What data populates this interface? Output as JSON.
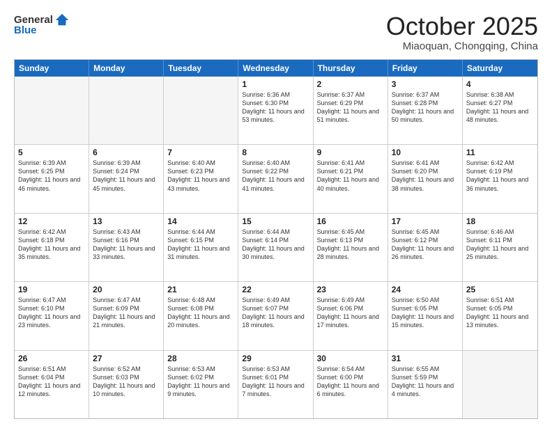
{
  "header": {
    "logo_general": "General",
    "logo_blue": "Blue",
    "month": "October 2025",
    "location": "Miaoquan, Chongqing, China"
  },
  "days_of_week": [
    "Sunday",
    "Monday",
    "Tuesday",
    "Wednesday",
    "Thursday",
    "Friday",
    "Saturday"
  ],
  "weeks": [
    [
      {
        "day": "",
        "empty": true
      },
      {
        "day": "",
        "empty": true
      },
      {
        "day": "",
        "empty": true
      },
      {
        "day": "1",
        "sunrise": "6:36 AM",
        "sunset": "6:30 PM",
        "daylight": "11 hours and 53 minutes."
      },
      {
        "day": "2",
        "sunrise": "6:37 AM",
        "sunset": "6:29 PM",
        "daylight": "11 hours and 51 minutes."
      },
      {
        "day": "3",
        "sunrise": "6:37 AM",
        "sunset": "6:28 PM",
        "daylight": "11 hours and 50 minutes."
      },
      {
        "day": "4",
        "sunrise": "6:38 AM",
        "sunset": "6:27 PM",
        "daylight": "11 hours and 48 minutes."
      }
    ],
    [
      {
        "day": "5",
        "sunrise": "6:39 AM",
        "sunset": "6:25 PM",
        "daylight": "11 hours and 46 minutes."
      },
      {
        "day": "6",
        "sunrise": "6:39 AM",
        "sunset": "6:24 PM",
        "daylight": "11 hours and 45 minutes."
      },
      {
        "day": "7",
        "sunrise": "6:40 AM",
        "sunset": "6:23 PM",
        "daylight": "11 hours and 43 minutes."
      },
      {
        "day": "8",
        "sunrise": "6:40 AM",
        "sunset": "6:22 PM",
        "daylight": "11 hours and 41 minutes."
      },
      {
        "day": "9",
        "sunrise": "6:41 AM",
        "sunset": "6:21 PM",
        "daylight": "11 hours and 40 minutes."
      },
      {
        "day": "10",
        "sunrise": "6:41 AM",
        "sunset": "6:20 PM",
        "daylight": "11 hours and 38 minutes."
      },
      {
        "day": "11",
        "sunrise": "6:42 AM",
        "sunset": "6:19 PM",
        "daylight": "11 hours and 36 minutes."
      }
    ],
    [
      {
        "day": "12",
        "sunrise": "6:42 AM",
        "sunset": "6:18 PM",
        "daylight": "11 hours and 35 minutes."
      },
      {
        "day": "13",
        "sunrise": "6:43 AM",
        "sunset": "6:16 PM",
        "daylight": "11 hours and 33 minutes."
      },
      {
        "day": "14",
        "sunrise": "6:44 AM",
        "sunset": "6:15 PM",
        "daylight": "11 hours and 31 minutes."
      },
      {
        "day": "15",
        "sunrise": "6:44 AM",
        "sunset": "6:14 PM",
        "daylight": "11 hours and 30 minutes."
      },
      {
        "day": "16",
        "sunrise": "6:45 AM",
        "sunset": "6:13 PM",
        "daylight": "11 hours and 28 minutes."
      },
      {
        "day": "17",
        "sunrise": "6:45 AM",
        "sunset": "6:12 PM",
        "daylight": "11 hours and 26 minutes."
      },
      {
        "day": "18",
        "sunrise": "6:46 AM",
        "sunset": "6:11 PM",
        "daylight": "11 hours and 25 minutes."
      }
    ],
    [
      {
        "day": "19",
        "sunrise": "6:47 AM",
        "sunset": "6:10 PM",
        "daylight": "11 hours and 23 minutes."
      },
      {
        "day": "20",
        "sunrise": "6:47 AM",
        "sunset": "6:09 PM",
        "daylight": "11 hours and 21 minutes."
      },
      {
        "day": "21",
        "sunrise": "6:48 AM",
        "sunset": "6:08 PM",
        "daylight": "11 hours and 20 minutes."
      },
      {
        "day": "22",
        "sunrise": "6:49 AM",
        "sunset": "6:07 PM",
        "daylight": "11 hours and 18 minutes."
      },
      {
        "day": "23",
        "sunrise": "6:49 AM",
        "sunset": "6:06 PM",
        "daylight": "11 hours and 17 minutes."
      },
      {
        "day": "24",
        "sunrise": "6:50 AM",
        "sunset": "6:05 PM",
        "daylight": "11 hours and 15 minutes."
      },
      {
        "day": "25",
        "sunrise": "6:51 AM",
        "sunset": "6:05 PM",
        "daylight": "11 hours and 13 minutes."
      }
    ],
    [
      {
        "day": "26",
        "sunrise": "6:51 AM",
        "sunset": "6:04 PM",
        "daylight": "11 hours and 12 minutes."
      },
      {
        "day": "27",
        "sunrise": "6:52 AM",
        "sunset": "6:03 PM",
        "daylight": "11 hours and 10 minutes."
      },
      {
        "day": "28",
        "sunrise": "6:53 AM",
        "sunset": "6:02 PM",
        "daylight": "11 hours and 9 minutes."
      },
      {
        "day": "29",
        "sunrise": "6:53 AM",
        "sunset": "6:01 PM",
        "daylight": "11 hours and 7 minutes."
      },
      {
        "day": "30",
        "sunrise": "6:54 AM",
        "sunset": "6:00 PM",
        "daylight": "11 hours and 6 minutes."
      },
      {
        "day": "31",
        "sunrise": "6:55 AM",
        "sunset": "5:59 PM",
        "daylight": "11 hours and 4 minutes."
      },
      {
        "day": "",
        "empty": true
      }
    ]
  ]
}
